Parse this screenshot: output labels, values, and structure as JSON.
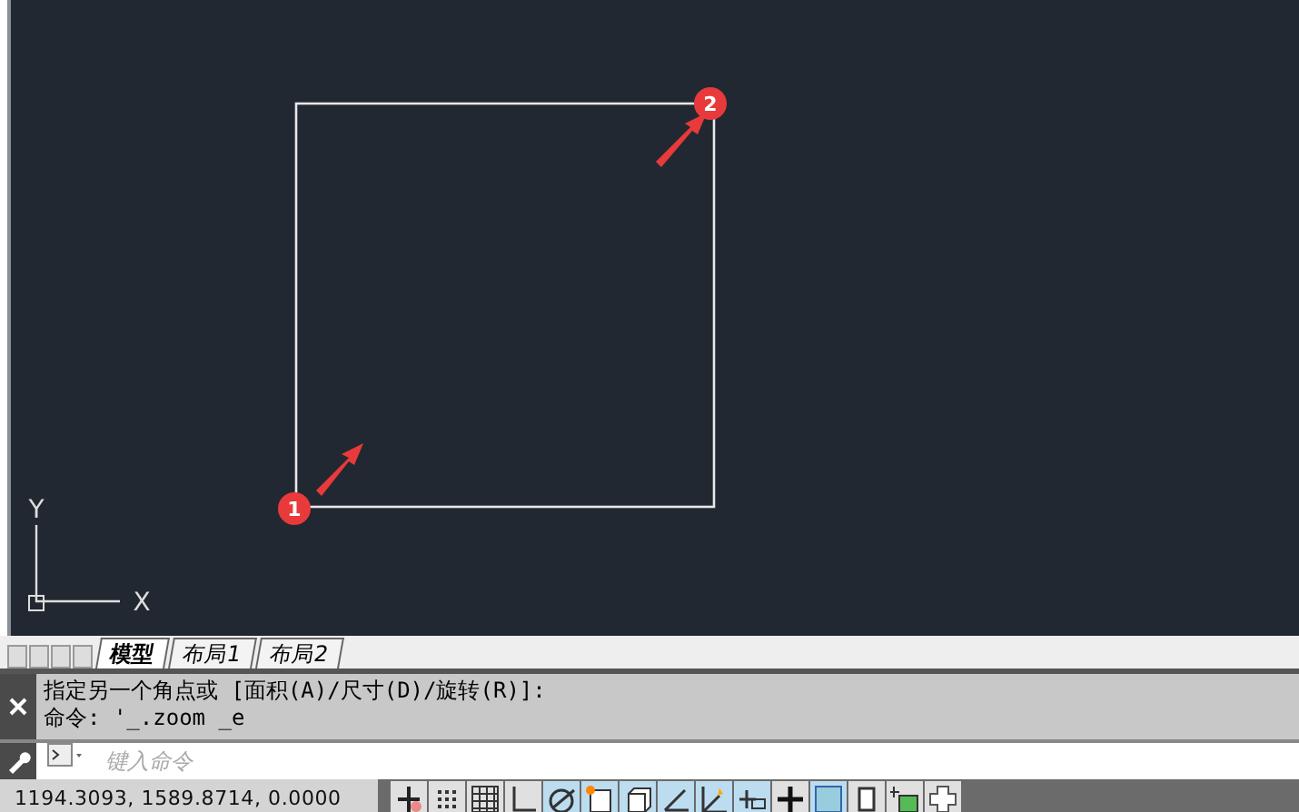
{
  "canvas": {
    "markers": [
      {
        "label": "1"
      },
      {
        "label": "2"
      }
    ],
    "ucs": {
      "x_label": "X",
      "y_label": "Y"
    }
  },
  "layout_tabs": [
    {
      "label": "模型",
      "selected": true
    },
    {
      "label": "布局1",
      "selected": false
    },
    {
      "label": "布局2",
      "selected": false
    }
  ],
  "command_history": [
    "指定另一个角点或 [面积(A)/尺寸(D)/旋转(R)]:",
    "命令: '_.zoom _e"
  ],
  "command_input": {
    "placeholder": "键入命令"
  },
  "status_bar": {
    "coordinates": "1194.3093, 1589.8714, 0.0000",
    "buttons": [
      {
        "kind": "infer",
        "on": false
      },
      {
        "kind": "snap",
        "on": false
      },
      {
        "kind": "grid",
        "on": false
      },
      {
        "kind": "ortho",
        "on": false
      },
      {
        "kind": "polar",
        "on": true
      },
      {
        "kind": "osnap",
        "on": true
      },
      {
        "kind": "osnap3d",
        "on": true
      },
      {
        "kind": "otrack",
        "on": true
      },
      {
        "kind": "ducs",
        "on": true
      },
      {
        "kind": "dyn",
        "on": true
      },
      {
        "kind": "lineweight",
        "on": false
      },
      {
        "kind": "transparency",
        "on": true
      },
      {
        "kind": "cycling",
        "on": false
      },
      {
        "kind": "annomonitor",
        "on": false
      },
      {
        "kind": "plus",
        "on": false
      }
    ]
  }
}
